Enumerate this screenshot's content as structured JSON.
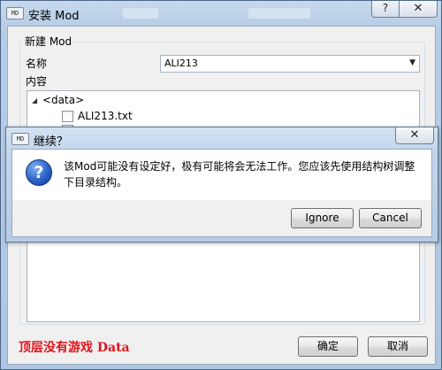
{
  "window": {
    "title": "安装 Mod",
    "app_icon_label": "MD",
    "help_symbol": "?",
    "close_symbol": "✕"
  },
  "form": {
    "group_title": "新建 Mod",
    "name_label": "名称",
    "name_value": "ALI213",
    "content_label": "内容",
    "tree": {
      "root": "<data>",
      "items": [
        "ALI213.txt"
      ]
    }
  },
  "status_text": "顶层没有游戏 Data",
  "buttons": {
    "ok": "确定",
    "cancel": "取消"
  },
  "dialog": {
    "title": "继续？",
    "app_icon_label": "MD",
    "close_symbol": "✕",
    "message": "该Mod可能没有设定好，极有可能将会无法工作。您应该先使用结构树调整下目录结构。",
    "ignore_label": "Ignore",
    "cancel_label": "Cancel"
  }
}
